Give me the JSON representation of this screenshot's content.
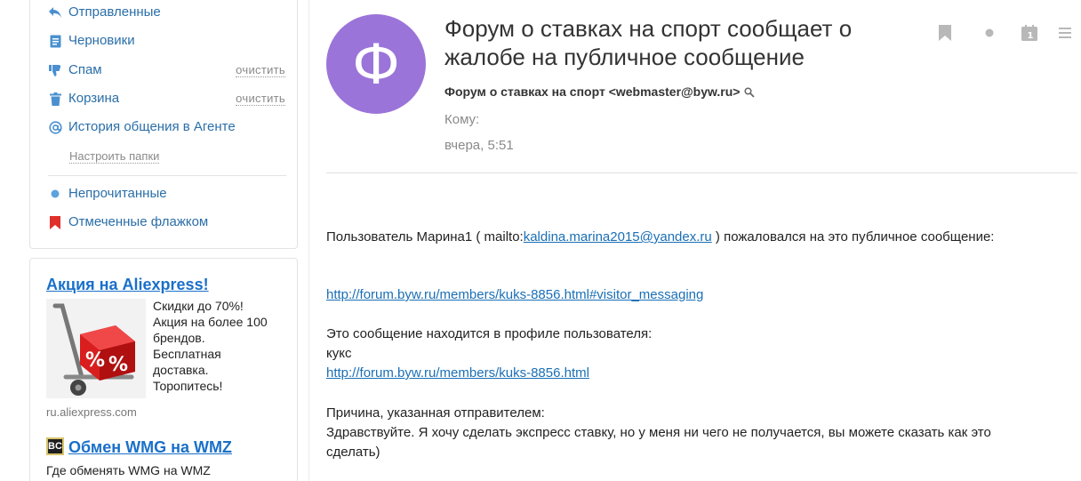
{
  "sidebar": {
    "folders": [
      {
        "id": "sent",
        "label": "Отправленные",
        "icon": "reply-arrow-icon",
        "clear": ""
      },
      {
        "id": "drafts",
        "label": "Черновики",
        "icon": "document-icon",
        "clear": ""
      },
      {
        "id": "spam",
        "label": "Спам",
        "icon": "thumbs-down-icon",
        "clear": "очистить"
      },
      {
        "id": "trash",
        "label": "Корзина",
        "icon": "trash-icon",
        "clear": "очистить"
      },
      {
        "id": "agent",
        "label": "История общения в Агенте",
        "icon": "at-sign-icon",
        "clear": ""
      }
    ],
    "setup_link": "Настроить папки",
    "filters": [
      {
        "id": "unread",
        "label": "Непрочитанные",
        "icon": "dot-icon"
      },
      {
        "id": "flagged",
        "label": "Отмеченные флажком",
        "icon": "flag-icon"
      }
    ],
    "ads": {
      "ad1": {
        "title": "Акция на Aliexpress!",
        "lines": [
          "Скидки до 70%!",
          "Акция на более 100",
          "брендов.",
          "Бесплатная",
          "доставка.",
          "Торопитесь!"
        ],
        "domain": "ru.aliexpress.com",
        "image_text": "%"
      },
      "ad2": {
        "logo_text": "BC",
        "title": "Обмен WMG на WMZ",
        "text": "Где обменять WMG на WMZ"
      }
    }
  },
  "message": {
    "avatar_letter": "Ф",
    "subject_line1": "Форум о ставках на спорт сообщает о",
    "subject_line2": "жалобе на публичное сообщение",
    "sender": "Форум о ставках на спорт <webmaster@byw.ru>",
    "to_label": "Кому:",
    "date": "вчера, 5:51",
    "toolbar_icons": [
      "bookmark-icon",
      "dot-icon",
      "calendar-icon",
      "menu-icon"
    ],
    "calendar_day": "1",
    "body": {
      "line1_prefix": "Пользователь Марина1 ( mailto:",
      "line1_email": "kaldina.marina2015@yandex.ru",
      "line1_suffix": " ) пожаловался на это публичное сообщение:",
      "link1": "http://forum.byw.ru/members/kuks-8856.html#visitor_messaging",
      "line3": "Это сообщение находится в профиле пользователя:",
      "line4": "кукс",
      "link2": "http://forum.byw.ru/members/kuks-8856.html",
      "line6": "Причина, указанная отправителем:",
      "line7": "Здравствуйте. Я хочу сделать экспресс ставку, но у меня ни чего не получается, вы можете сказать как это",
      "line8": "сделать)"
    }
  },
  "colors": {
    "link": "#2a6ea8",
    "avatar": "#9b74d9",
    "flag": "#e0302a",
    "unread_dot": "#5ca3df",
    "ad_link": "#1a70c9"
  }
}
